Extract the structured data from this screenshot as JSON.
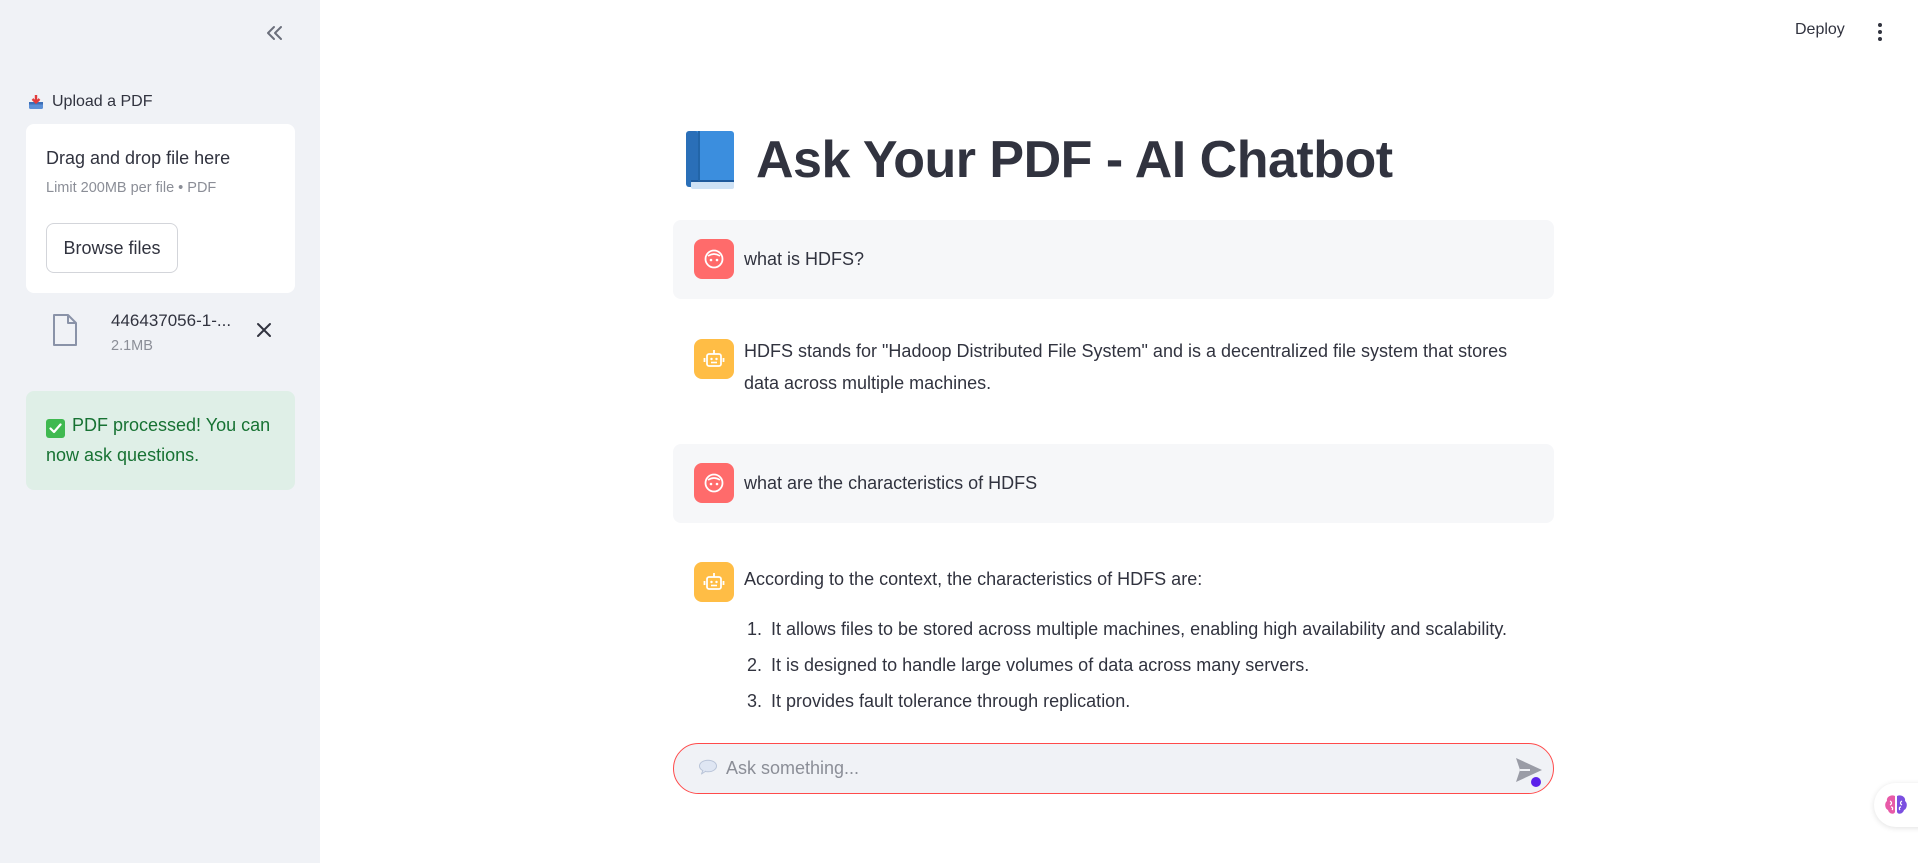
{
  "sidebar": {
    "collapse_icon": "double-chevron-left-icon",
    "upload_label": "Upload a PDF",
    "upload_label_icon": "inbox-tray-icon",
    "dropzone": {
      "title": "Drag and drop file here",
      "subtitle": "Limit 200MB per file • PDF",
      "browse_label": "Browse files"
    },
    "file": {
      "name": "446437056-1-...",
      "size": "2.1MB",
      "icon": "file-icon",
      "remove_icon": "close-icon"
    },
    "status": {
      "icon": "check-mark-icon",
      "text": "PDF processed! You can now ask questions."
    }
  },
  "header": {
    "deploy_label": "Deploy",
    "menu_icon": "kebab-menu-icon"
  },
  "main": {
    "title_icon": "blue-book-icon",
    "title": "Ask Your PDF - AI Chatbot",
    "messages": [
      {
        "role": "user",
        "text": "what is HDFS?"
      },
      {
        "role": "assistant",
        "lines": [
          "HDFS stands for \"Hadoop Distributed File System\" and is a decentralized file system that stores",
          "data across multiple machines."
        ]
      },
      {
        "role": "user",
        "text": "what are the characteristics of HDFS"
      },
      {
        "role": "assistant",
        "text": "According to the context, the characteristics of HDFS are:",
        "list": [
          {
            "num": "1.",
            "text": "It allows files to be stored across multiple machines, enabling high availability and scalability."
          },
          {
            "num": "2.",
            "text": "It is designed to handle large volumes of data across many servers."
          },
          {
            "num": "3.",
            "text": "It provides fault tolerance through replication."
          }
        ]
      }
    ],
    "chat_input": {
      "placeholder": "Ask something...",
      "value": "",
      "bubble_icon": "speech-bubble-icon",
      "send_icon": "send-icon"
    }
  },
  "colors": {
    "sidebar_bg": "#f0f2f6",
    "user_avatar": "#ff6b6b",
    "bot_avatar": "#ffbd45",
    "success_bg": "#dfefe7",
    "success_text": "#177233",
    "accent_red": "#ff4b4b"
  },
  "widget": {
    "icon": "brain-icon"
  }
}
